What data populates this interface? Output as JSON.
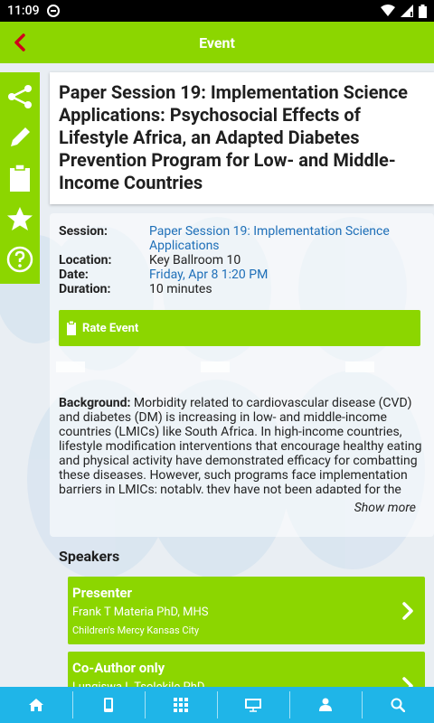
{
  "status_bar": {
    "time": "11:09"
  },
  "app_bar": {
    "title": "Event"
  },
  "side_tools": [
    {
      "icon": "share-icon"
    },
    {
      "icon": "pencil-icon"
    },
    {
      "icon": "clipboard-icon"
    },
    {
      "icon": "star-icon"
    },
    {
      "icon": "help-icon"
    }
  ],
  "event": {
    "title": "Paper Session 19: Implementation Science Applications: Psychosocial Effects of Lifestyle Africa, an Adapted Diabetes Prevention Program for Low- and Middle- Income Countries",
    "session_label": "Session:",
    "session_value_line1": "Paper Session 19: Implementation Science",
    "session_value_line2": "Applications",
    "location_label": "Location:",
    "location_value": "Key Ballroom 10",
    "date_label": "Date:",
    "date_value": "Friday, Apr 8 1:20 PM",
    "duration_label": "Duration:",
    "duration_value": "10 minutes",
    "rate_label": "Rate Event",
    "abstract_label": "Background:",
    "abstract_text": "Morbidity related to cardiovascular disease (CVD) and diabetes (DM) is increasing in low- and middle-income countries (LMICs) like South Africa. In high-income countries, lifestyle modification interventions that encourage healthy eating and physical activity have demonstrated efficacy for combatting these diseases. However, such programs face implementation barriers in LMICs; notably, they have not been adapted for the",
    "show_more": "Show more"
  },
  "speakers": {
    "title": "Speakers",
    "items": [
      {
        "role": "Presenter",
        "name": "Frank T Materia PhD, MHS",
        "affiliation": "Children's Mercy Kansas City"
      },
      {
        "role": "Co-Author only",
        "name": "Lungiswa L Tsolekile PhD",
        "affiliation": ""
      }
    ]
  },
  "tab_bar": [
    {
      "icon": "home-icon"
    },
    {
      "icon": "mobile-icon"
    },
    {
      "icon": "grid-icon"
    },
    {
      "icon": "presentation-icon"
    },
    {
      "icon": "people-icon"
    },
    {
      "icon": "search-icon"
    }
  ],
  "colors": {
    "accent": "#8cd600",
    "tab_bar": "#1fb5e8",
    "link": "#1e6fb8"
  }
}
